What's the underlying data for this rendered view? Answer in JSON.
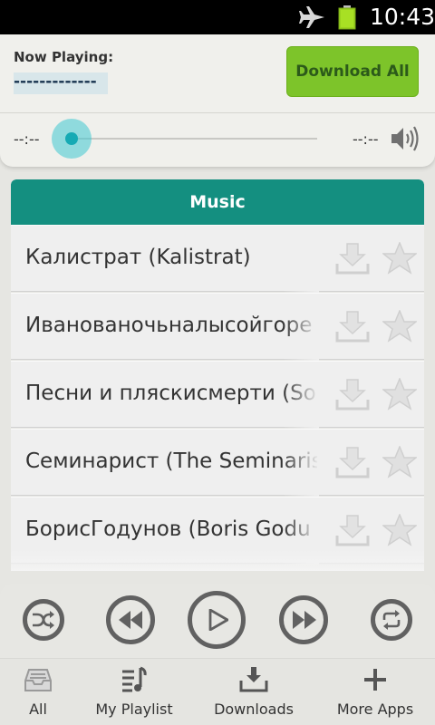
{
  "status_bar": {
    "time": "10:43",
    "icons": [
      "airplane-mode-icon",
      "battery-icon"
    ]
  },
  "header": {
    "now_playing_label": "Now Playing:",
    "now_playing_value": "-------------",
    "download_all_label": "Download All",
    "time_elapsed": "--:--",
    "time_total": "--:--",
    "seek_progress": 0
  },
  "music": {
    "title": "Music",
    "tracks": [
      {
        "title": "Калистрат (Kalistrat)"
      },
      {
        "title": "Иванованочьналысойгоре"
      },
      {
        "title": "Песни и пляскисмерти (So"
      },
      {
        "title": "Семинарист (The Seminaris"
      },
      {
        "title": "БорисГодунов (Boris Godu"
      }
    ]
  },
  "player": {
    "buttons": [
      "shuffle",
      "rewind",
      "play",
      "fast-forward",
      "repeat"
    ]
  },
  "tabs": [
    {
      "label": "All",
      "icon": "inbox-icon",
      "selected": true
    },
    {
      "label": "My Playlist",
      "icon": "playlist-icon"
    },
    {
      "label": "Downloads",
      "icon": "downloads-icon"
    },
    {
      "label": "More Apps",
      "icon": "plus-icon"
    }
  ],
  "colors": {
    "accent_teal": "#148f80",
    "download_green": "#7dc42a",
    "seek_knob": "#16aab4"
  }
}
